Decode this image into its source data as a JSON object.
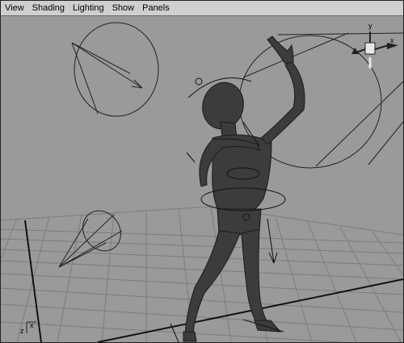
{
  "menubar": {
    "items": [
      "View",
      "Shading",
      "Lighting",
      "Show",
      "Panels"
    ]
  },
  "view_cube": {
    "y_label": "y",
    "x_label": "x"
  },
  "corner_axis": {
    "z_label": "z",
    "x_label": "x"
  },
  "colors": {
    "viewport_bg": "#9a9a9a",
    "grid_line": "#7c7c7c",
    "grid_axis": "#111111",
    "figure": "#3c3c3c",
    "wire": "#202020"
  }
}
